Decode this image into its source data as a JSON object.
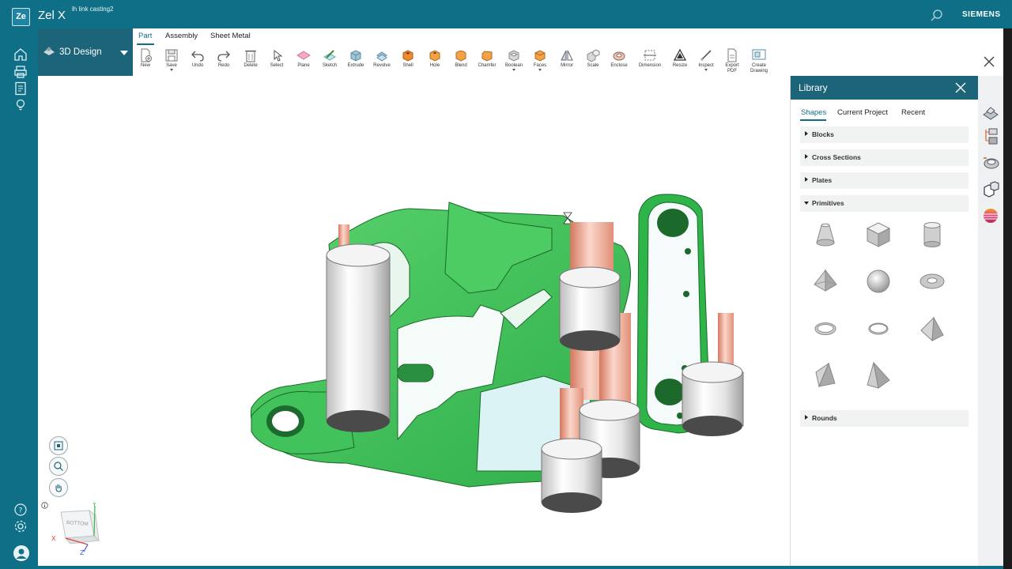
{
  "app": {
    "logo_text": "Ze",
    "title": "Zel X",
    "file_name": "lh link casting2",
    "brand": "SIEMENS"
  },
  "left_rail": {
    "items": [
      {
        "icon": "home-icon"
      },
      {
        "icon": "printer-icon"
      },
      {
        "icon": "document-icon"
      },
      {
        "icon": "lightbulb-icon"
      }
    ],
    "bottom": [
      {
        "icon": "help-icon"
      },
      {
        "icon": "settings-icon"
      },
      {
        "icon": "user-avatar-icon"
      }
    ]
  },
  "ribbon": {
    "workspace": "3D Design",
    "tabs": [
      {
        "label": "Part",
        "active": true
      },
      {
        "label": "Assembly",
        "active": false
      },
      {
        "label": "Sheet Metal",
        "active": false
      }
    ],
    "tools": [
      {
        "label": "New",
        "icon": "new-document-icon"
      },
      {
        "label": "Save",
        "icon": "save-icon",
        "dropdown": true
      },
      {
        "label": "Undo",
        "icon": "undo-icon"
      },
      {
        "label": "Redo",
        "icon": "redo-icon"
      },
      {
        "label": "Delete",
        "icon": "delete-icon"
      },
      {
        "label": "Select",
        "icon": "select-cursor-icon"
      },
      {
        "label": "Plane",
        "icon": "plane-icon"
      },
      {
        "label": "Sketch",
        "icon": "sketch-icon"
      },
      {
        "label": "Extrude",
        "icon": "extrude-icon"
      },
      {
        "label": "Revolve",
        "icon": "revolve-icon"
      },
      {
        "label": "Shell",
        "icon": "shell-icon"
      },
      {
        "label": "Hole",
        "icon": "hole-icon"
      },
      {
        "label": "Blend",
        "icon": "blend-icon"
      },
      {
        "label": "Chamfer",
        "icon": "chamfer-icon"
      },
      {
        "label": "Boolean",
        "icon": "boolean-icon",
        "dropdown": true
      },
      {
        "label": "Faces",
        "icon": "faces-icon",
        "dropdown": true
      },
      {
        "label": "Mirror",
        "icon": "mirror-icon"
      },
      {
        "label": "Scale",
        "icon": "scale-icon"
      },
      {
        "label": "Enclose",
        "icon": "enclose-icon"
      },
      {
        "label": "Dimension",
        "icon": "dimension-icon"
      },
      {
        "label": "Resize",
        "icon": "resize-icon"
      },
      {
        "label": "Inspect",
        "icon": "inspect-icon",
        "dropdown": true
      },
      {
        "label": "Export\nPDF",
        "line1": "Export",
        "line2": "PDF",
        "icon": "export-pdf-icon"
      },
      {
        "label": "Create\nDrawing",
        "line1": "Create",
        "line2": "Drawing",
        "icon": "create-drawing-icon"
      }
    ]
  },
  "viewport": {
    "view_cube_face": "BOTTOM",
    "axes": {
      "x": "X",
      "y": "Y",
      "z": "Z"
    },
    "model_color": "#3cc15a",
    "nav_buttons": [
      {
        "icon": "fit-view-icon"
      },
      {
        "icon": "zoom-icon"
      },
      {
        "icon": "pan-hand-icon"
      }
    ]
  },
  "library": {
    "title": "Library",
    "tabs": [
      {
        "label": "Shapes",
        "active": true
      },
      {
        "label": "Current Project",
        "active": false
      },
      {
        "label": "Recent",
        "active": false
      }
    ],
    "categories": [
      {
        "label": "Blocks",
        "expanded": false
      },
      {
        "label": "Cross Sections",
        "expanded": false
      },
      {
        "label": "Plates",
        "expanded": false
      },
      {
        "label": "Primitives",
        "expanded": true
      },
      {
        "label": "Rounds",
        "expanded": false
      }
    ],
    "primitives": [
      {
        "name": "cone-shape-icon"
      },
      {
        "name": "cube-shape-icon"
      },
      {
        "name": "cylinder-shape-icon"
      },
      {
        "name": "pyramid-shape-icon"
      },
      {
        "name": "sphere-shape-icon"
      },
      {
        "name": "torus-shape-icon"
      },
      {
        "name": "ring-shape-icon"
      },
      {
        "name": "thin-ring-shape-icon"
      },
      {
        "name": "wedge-shape-icon"
      },
      {
        "name": "tetrahedron-shape-icon"
      },
      {
        "name": "prism-shape-icon"
      }
    ]
  },
  "colors": {
    "brand_teal": "#0e6f86",
    "header_dark_teal": "#1b6479",
    "model_green": "#3cc15a",
    "boss_silver": "#e6e6e6",
    "salmon_face": "#e49c88"
  }
}
